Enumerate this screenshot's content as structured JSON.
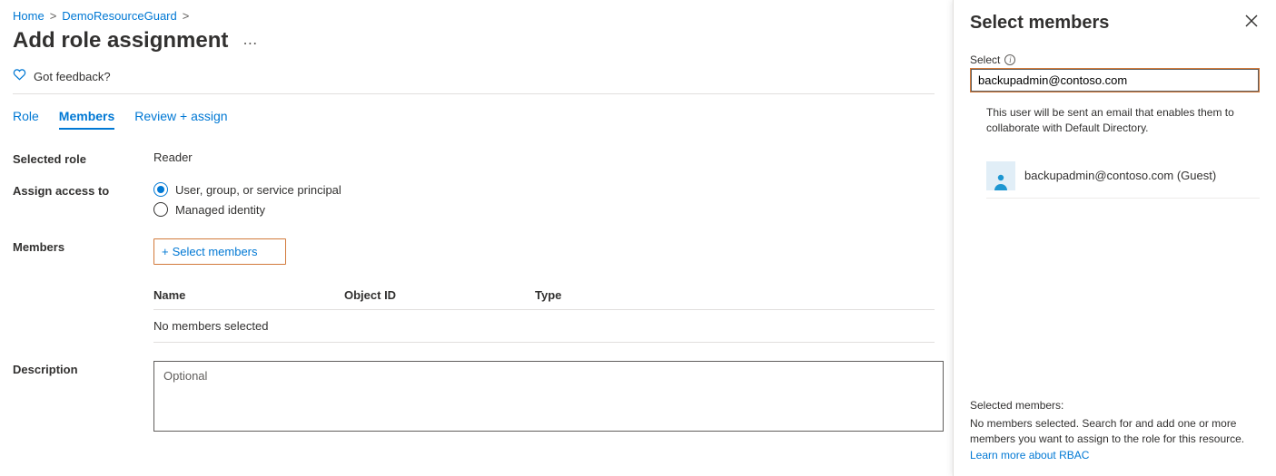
{
  "breadcrumb": {
    "home": "Home",
    "resource": "DemoResourceGuard"
  },
  "page_title": "Add role assignment",
  "feedback_label": "Got feedback?",
  "tabs": {
    "role": "Role",
    "members": "Members",
    "review": "Review + assign"
  },
  "form": {
    "selected_role_label": "Selected role",
    "selected_role_value": "Reader",
    "assign_access_label": "Assign access to",
    "assign_option_user": "User, group, or service principal",
    "assign_option_mi": "Managed identity",
    "members_label": "Members",
    "select_members_link": "Select members",
    "description_label": "Description",
    "description_placeholder": "Optional"
  },
  "members_table": {
    "col_name": "Name",
    "col_obj": "Object ID",
    "col_type": "Type",
    "empty": "No members selected"
  },
  "side": {
    "title": "Select members",
    "search_label": "Select",
    "search_value": "backupadmin@contoso.com",
    "note": "This user will be sent an email that enables them to collaborate with Default Directory.",
    "result_name": "backupadmin@contoso.com (Guest)",
    "selected_heading": "Selected members:",
    "selected_hint": "No members selected. Search for and add one or more members you want to assign to the role for this resource.",
    "learn_more": "Learn more about RBAC"
  }
}
